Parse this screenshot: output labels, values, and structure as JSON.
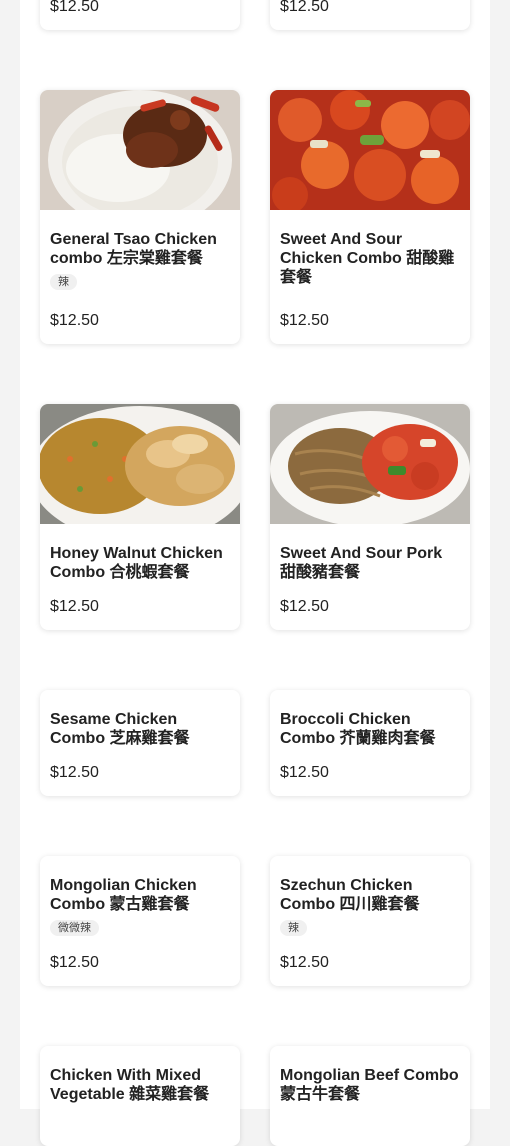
{
  "cards": [
    {
      "name": "",
      "price": "$12.50"
    },
    {
      "name": "",
      "price": "$12.50"
    },
    {
      "name": "General Tsao Chicken combo 左宗棠雞套餐",
      "badge": "辣",
      "price": "$12.50"
    },
    {
      "name": "Sweet And Sour Chicken Combo 甜酸雞套餐",
      "price": "$12.50"
    },
    {
      "name": "Honey Walnut Chicken Combo 合桃蝦套餐",
      "price": "$12.50"
    },
    {
      "name": "Sweet And Sour Pork 甜酸豬套餐",
      "price": "$12.50"
    },
    {
      "name": "Sesame Chicken Combo 芝麻雞套餐",
      "price": "$12.50"
    },
    {
      "name": "Broccoli Chicken Combo 芥蘭雞肉套餐",
      "price": "$12.50"
    },
    {
      "name": "Mongolian Chicken Combo 蒙古雞套餐",
      "badge": "微微辣",
      "price": "$12.50"
    },
    {
      "name": "Szechun Chicken Combo 四川雞套餐",
      "badge": "辣",
      "price": "$12.50"
    },
    {
      "name": "Chicken With Mixed Vegetable 雜菜雞套餐",
      "price": ""
    },
    {
      "name": "Mongolian Beef Combo 蒙古牛套餐",
      "price": ""
    }
  ]
}
